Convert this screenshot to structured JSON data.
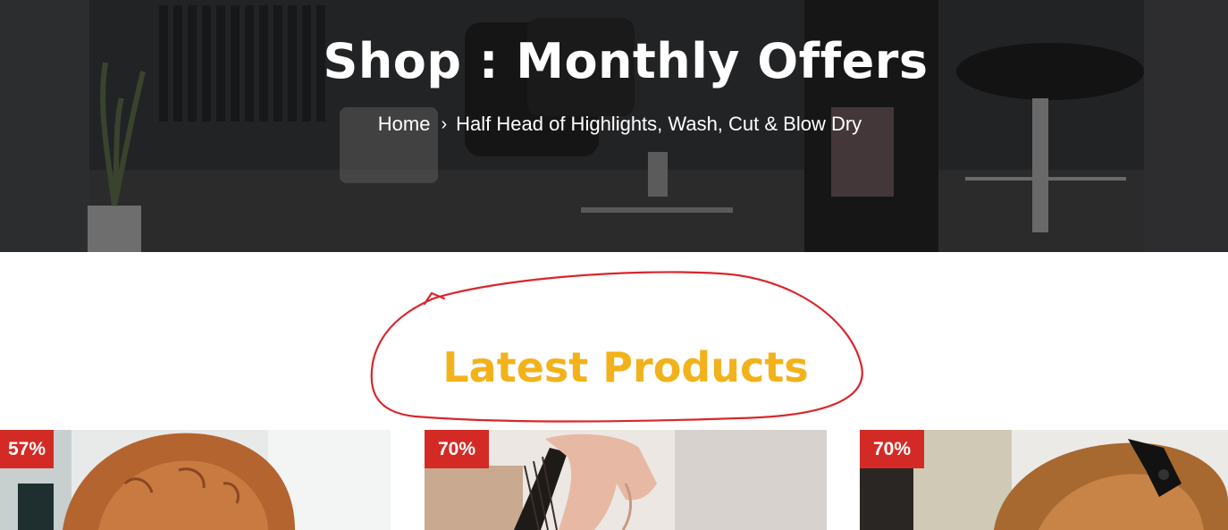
{
  "hero": {
    "title": "Shop : Monthly Offers",
    "breadcrumb": {
      "home_label": "Home",
      "separator": "›",
      "current": "Half Head of Highlights, Wash, Cut & Blow Dry"
    }
  },
  "section": {
    "title": "Latest Products",
    "title_color": "#f2b21b",
    "annotation_color": "#d9262c"
  },
  "products": [
    {
      "discount_badge": "57%",
      "image_icon": "curly-hair-photo-icon"
    },
    {
      "discount_badge": "70%",
      "image_icon": "hair-brushing-photo-icon"
    },
    {
      "discount_badge": "70%",
      "image_icon": "hair-clip-photo-icon"
    }
  ],
  "colors": {
    "badge": "#d42a25",
    "hero_overlay": "#2b2b2c"
  }
}
